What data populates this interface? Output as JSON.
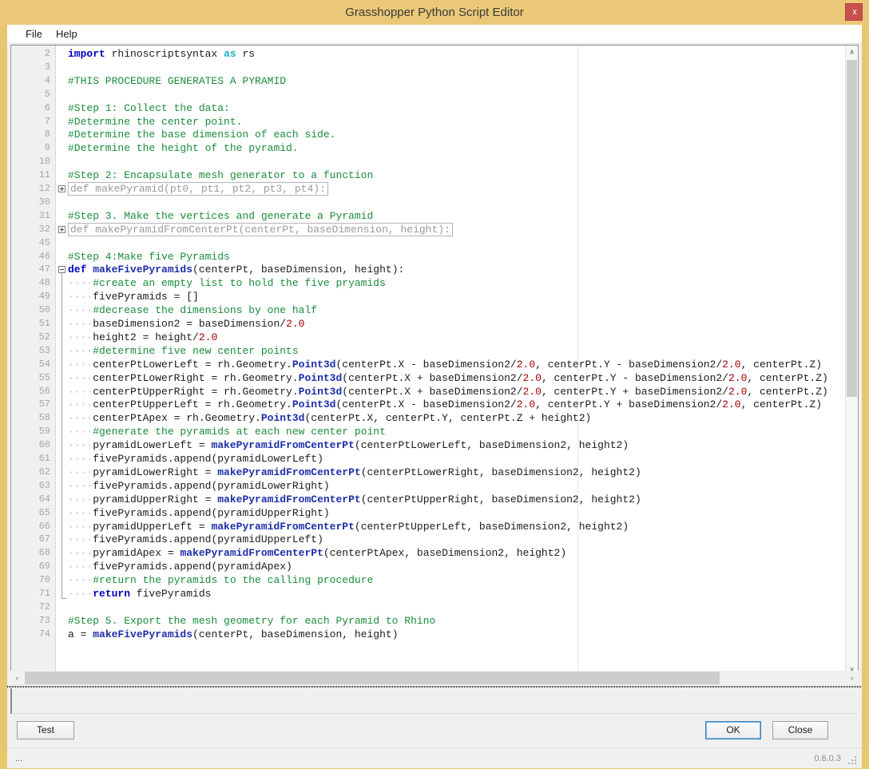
{
  "window": {
    "title": "Grasshopper Python Script Editor",
    "close_label": "x",
    "accent_color": "#eac878",
    "close_color": "#c9504e"
  },
  "menu": {
    "items": [
      {
        "label": "File"
      },
      {
        "label": "Help"
      }
    ]
  },
  "editor": {
    "first_visible_line": 2,
    "lines": [
      {
        "n": "2",
        "fold": "none",
        "tokens": [
          {
            "t": "import",
            "c": "kw"
          },
          {
            "t": " rhinoscriptsyntax ",
            "c": ""
          },
          {
            "t": "as",
            "c": "kw2"
          },
          {
            "t": " rs",
            "c": ""
          }
        ]
      },
      {
        "n": "3",
        "fold": "none",
        "tokens": []
      },
      {
        "n": "4",
        "fold": "none",
        "tokens": [
          {
            "t": "#THIS PROCEDURE GENERATES A PYRAMID",
            "c": "cm"
          }
        ]
      },
      {
        "n": "5",
        "fold": "none",
        "tokens": []
      },
      {
        "n": "6",
        "fold": "none",
        "tokens": [
          {
            "t": "#Step 1: Collect the data:",
            "c": "cm"
          }
        ]
      },
      {
        "n": "7",
        "fold": "none",
        "tokens": [
          {
            "t": "#Determine the center point.",
            "c": "cm"
          }
        ]
      },
      {
        "n": "8",
        "fold": "none",
        "tokens": [
          {
            "t": "#Determine the base dimension of each side.",
            "c": "cm"
          }
        ]
      },
      {
        "n": "9",
        "fold": "none",
        "tokens": [
          {
            "t": "#Determine the height of the pyramid.",
            "c": "cm"
          }
        ]
      },
      {
        "n": "10",
        "fold": "none",
        "tokens": []
      },
      {
        "n": "11",
        "fold": "none",
        "tokens": [
          {
            "t": "#Step 2: Encapsulate mesh generator to a function",
            "c": "cm"
          }
        ]
      },
      {
        "n": "12",
        "fold": "plus",
        "collapsed": "def makePyramid(pt0, pt1, pt2, pt3, pt4):"
      },
      {
        "n": "30",
        "fold": "none",
        "tokens": []
      },
      {
        "n": "31",
        "fold": "none",
        "tokens": [
          {
            "t": "#Step 3. Make the vertices and generate a Pyramid",
            "c": "cm"
          }
        ]
      },
      {
        "n": "32",
        "fold": "plus",
        "collapsed": "def makePyramidFromCenterPt(centerPt, baseDimension, height):"
      },
      {
        "n": "45",
        "fold": "none",
        "tokens": []
      },
      {
        "n": "46",
        "fold": "none",
        "tokens": [
          {
            "t": "#Step 4:Make five Pyramids",
            "c": "cm"
          }
        ]
      },
      {
        "n": "47",
        "fold": "minus",
        "tokens": [
          {
            "t": "def",
            "c": "kw"
          },
          {
            "t": " ",
            "c": ""
          },
          {
            "t": "makeFivePyramids",
            "c": "fn"
          },
          {
            "t": "(centerPt, baseDimension, height):",
            "c": ""
          }
        ]
      },
      {
        "n": "48",
        "fold": "stem",
        "tokens": [
          {
            "t": "····",
            "c": "ws"
          },
          {
            "t": "#create an empty list to hold the five pryamids",
            "c": "cm"
          }
        ]
      },
      {
        "n": "49",
        "fold": "stem",
        "tokens": [
          {
            "t": "····",
            "c": "ws"
          },
          {
            "t": "fivePyramids = []",
            "c": ""
          }
        ]
      },
      {
        "n": "50",
        "fold": "stem",
        "tokens": [
          {
            "t": "····",
            "c": "ws"
          },
          {
            "t": "#decrease the dimensions by one half",
            "c": "cm"
          }
        ]
      },
      {
        "n": "51",
        "fold": "stem",
        "tokens": [
          {
            "t": "····",
            "c": "ws"
          },
          {
            "t": "baseDimension2 = baseDimension/",
            "c": ""
          },
          {
            "t": "2.0",
            "c": "num"
          }
        ]
      },
      {
        "n": "52",
        "fold": "stem",
        "tokens": [
          {
            "t": "····",
            "c": "ws"
          },
          {
            "t": "height2 = height/",
            "c": ""
          },
          {
            "t": "2.0",
            "c": "num"
          }
        ]
      },
      {
        "n": "53",
        "fold": "stem",
        "tokens": [
          {
            "t": "····",
            "c": "ws"
          },
          {
            "t": "#determine five new center points",
            "c": "cm"
          }
        ]
      },
      {
        "n": "54",
        "fold": "stem",
        "tokens": [
          {
            "t": "····",
            "c": "ws"
          },
          {
            "t": "centerPtLowerLeft = rh.Geometry.",
            "c": ""
          },
          {
            "t": "Point3d",
            "c": "fn"
          },
          {
            "t": "(centerPt.X - baseDimension2/",
            "c": ""
          },
          {
            "t": "2.0",
            "c": "num"
          },
          {
            "t": ", centerPt.Y - baseDimension2/",
            "c": ""
          },
          {
            "t": "2.0",
            "c": "num"
          },
          {
            "t": ", centerPt.Z)",
            "c": ""
          }
        ]
      },
      {
        "n": "55",
        "fold": "stem",
        "tokens": [
          {
            "t": "····",
            "c": "ws"
          },
          {
            "t": "centerPtLowerRight = rh.Geometry.",
            "c": ""
          },
          {
            "t": "Point3d",
            "c": "fn"
          },
          {
            "t": "(centerPt.X + baseDimension2/",
            "c": ""
          },
          {
            "t": "2.0",
            "c": "num"
          },
          {
            "t": ", centerPt.Y - baseDimension2/",
            "c": ""
          },
          {
            "t": "2.0",
            "c": "num"
          },
          {
            "t": ", centerPt.Z)",
            "c": ""
          }
        ]
      },
      {
        "n": "56",
        "fold": "stem",
        "tokens": [
          {
            "t": "····",
            "c": "ws"
          },
          {
            "t": "centerPtUpperRight = rh.Geometry.",
            "c": ""
          },
          {
            "t": "Point3d",
            "c": "fn"
          },
          {
            "t": "(centerPt.X + baseDimension2/",
            "c": ""
          },
          {
            "t": "2.0",
            "c": "num"
          },
          {
            "t": ", centerPt.Y + baseDimension2/",
            "c": ""
          },
          {
            "t": "2.0",
            "c": "num"
          },
          {
            "t": ", centerPt.Z)",
            "c": ""
          }
        ]
      },
      {
        "n": "57",
        "fold": "stem",
        "tokens": [
          {
            "t": "····",
            "c": "ws"
          },
          {
            "t": "centerPtUpperLeft = rh.Geometry.",
            "c": ""
          },
          {
            "t": "Point3d",
            "c": "fn"
          },
          {
            "t": "(centerPt.X - baseDimension2/",
            "c": ""
          },
          {
            "t": "2.0",
            "c": "num"
          },
          {
            "t": ", centerPt.Y + baseDimension2/",
            "c": ""
          },
          {
            "t": "2.0",
            "c": "num"
          },
          {
            "t": ", centerPt.Z)",
            "c": ""
          }
        ]
      },
      {
        "n": "58",
        "fold": "stem",
        "tokens": [
          {
            "t": "····",
            "c": "ws"
          },
          {
            "t": "centerPtApex = rh.Geometry.",
            "c": ""
          },
          {
            "t": "Point3d",
            "c": "fn"
          },
          {
            "t": "(centerPt.X, centerPt.Y, centerPt.Z + height2)",
            "c": ""
          }
        ]
      },
      {
        "n": "59",
        "fold": "stem",
        "tokens": [
          {
            "t": "····",
            "c": "ws"
          },
          {
            "t": "#generate the pyramids at each new center point",
            "c": "cm"
          }
        ]
      },
      {
        "n": "60",
        "fold": "stem",
        "tokens": [
          {
            "t": "····",
            "c": "ws"
          },
          {
            "t": "pyramidLowerLeft = ",
            "c": ""
          },
          {
            "t": "makePyramidFromCenterPt",
            "c": "fn"
          },
          {
            "t": "(centerPtLowerLeft, baseDimension2, height2)",
            "c": ""
          }
        ]
      },
      {
        "n": "61",
        "fold": "stem",
        "tokens": [
          {
            "t": "····",
            "c": "ws"
          },
          {
            "t": "fivePyramids.append(pyramidLowerLeft)",
            "c": ""
          }
        ]
      },
      {
        "n": "62",
        "fold": "stem",
        "tokens": [
          {
            "t": "····",
            "c": "ws"
          },
          {
            "t": "pyramidLowerRight = ",
            "c": ""
          },
          {
            "t": "makePyramidFromCenterPt",
            "c": "fn"
          },
          {
            "t": "(centerPtLowerRight, baseDimension2, height2)",
            "c": ""
          }
        ]
      },
      {
        "n": "63",
        "fold": "stem",
        "tokens": [
          {
            "t": "····",
            "c": "ws"
          },
          {
            "t": "fivePyramids.append(pyramidLowerRight)",
            "c": ""
          }
        ]
      },
      {
        "n": "64",
        "fold": "stem",
        "tokens": [
          {
            "t": "····",
            "c": "ws"
          },
          {
            "t": "pyramidUpperRight = ",
            "c": ""
          },
          {
            "t": "makePyramidFromCenterPt",
            "c": "fn"
          },
          {
            "t": "(centerPtUpperRight, baseDimension2, height2)",
            "c": ""
          }
        ]
      },
      {
        "n": "65",
        "fold": "stem",
        "tokens": [
          {
            "t": "····",
            "c": "ws"
          },
          {
            "t": "fivePyramids.append(pyramidUpperRight)",
            "c": ""
          }
        ]
      },
      {
        "n": "66",
        "fold": "stem",
        "tokens": [
          {
            "t": "····",
            "c": "ws"
          },
          {
            "t": "pyramidUpperLeft = ",
            "c": ""
          },
          {
            "t": "makePyramidFromCenterPt",
            "c": "fn"
          },
          {
            "t": "(centerPtUpperLeft, baseDimension2, height2)",
            "c": ""
          }
        ]
      },
      {
        "n": "67",
        "fold": "stem",
        "tokens": [
          {
            "t": "····",
            "c": "ws"
          },
          {
            "t": "fivePyramids.append(pyramidUpperLeft)",
            "c": ""
          }
        ]
      },
      {
        "n": "68",
        "fold": "stem",
        "tokens": [
          {
            "t": "····",
            "c": "ws"
          },
          {
            "t": "pyramidApex = ",
            "c": ""
          },
          {
            "t": "makePyramidFromCenterPt",
            "c": "fn"
          },
          {
            "t": "(centerPtApex, baseDimension2, height2)",
            "c": ""
          }
        ]
      },
      {
        "n": "69",
        "fold": "stem",
        "tokens": [
          {
            "t": "····",
            "c": "ws"
          },
          {
            "t": "fivePyramids.append(pyramidApex)",
            "c": ""
          }
        ]
      },
      {
        "n": "70",
        "fold": "stem",
        "tokens": [
          {
            "t": "····",
            "c": "ws"
          },
          {
            "t": "#return the pyramids to the calling procedure",
            "c": "cm"
          }
        ]
      },
      {
        "n": "71",
        "fold": "end",
        "tokens": [
          {
            "t": "····",
            "c": "ws"
          },
          {
            "t": "return",
            "c": "kw"
          },
          {
            "t": " fivePyramids",
            "c": ""
          }
        ]
      },
      {
        "n": "72",
        "fold": "none",
        "tokens": []
      },
      {
        "n": "73",
        "fold": "none",
        "tokens": [
          {
            "t": "#Step 5. Export the mesh geometry for each Pyramid to Rhino",
            "c": "cm"
          }
        ]
      },
      {
        "n": "74",
        "fold": "none",
        "tokens": [
          {
            "t": "a = ",
            "c": ""
          },
          {
            "t": "makeFivePyramids",
            "c": "fn"
          },
          {
            "t": "(centerPt, baseDimension, height)",
            "c": ""
          }
        ]
      }
    ]
  },
  "scrollbars": {
    "vertical_up_glyph": "∧",
    "vertical_down_glyph": "∨",
    "horizontal_left_glyph": "‹",
    "horizontal_right_glyph": "›"
  },
  "output": {
    "text": ""
  },
  "buttons": {
    "test": "Test",
    "ok": "OK",
    "close": "Close"
  },
  "status": {
    "left": "...",
    "version": "0.6.0.3"
  }
}
